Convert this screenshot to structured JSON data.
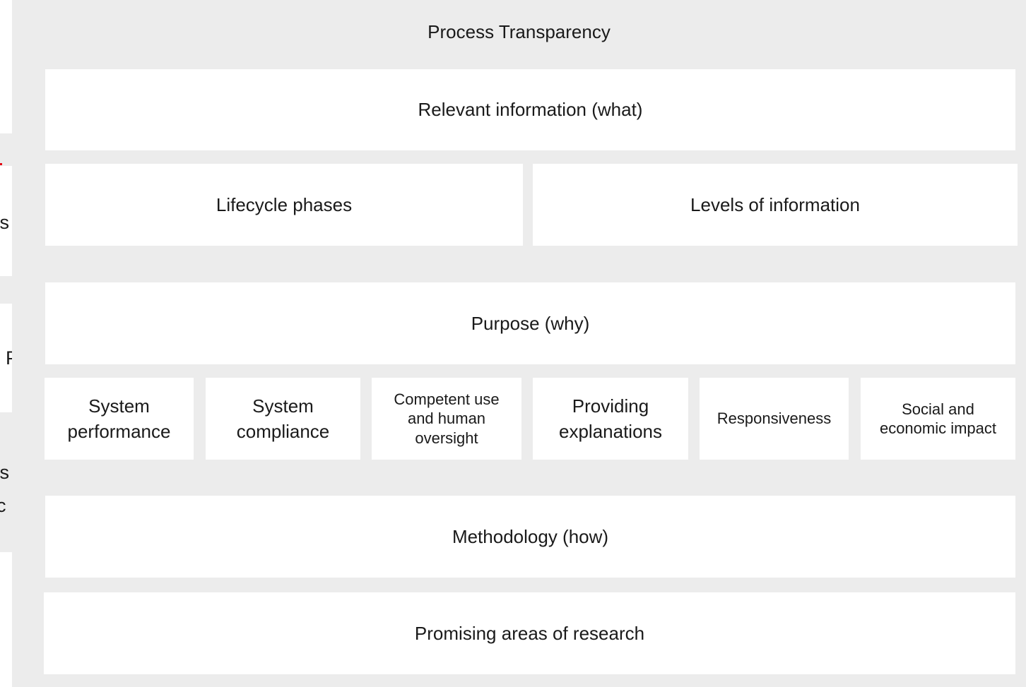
{
  "left_fragments": [
    "ys",
    "P",
    "ys",
    "rc"
  ],
  "title": "Process Transparency",
  "what": "Relevant information (what)",
  "lifecycle": "Lifecycle phases",
  "levels": "Levels of information",
  "why": "Purpose (why)",
  "purposes": [
    "System performance",
    "System compliance",
    "Competent use and human oversight",
    "Providing explanations",
    "Responsiveness",
    "Social and economic impact"
  ],
  "how": "Methodology (how)",
  "research": "Promising areas of research",
  "colors": {
    "panel": "#ececec",
    "box": "#ffffff",
    "accent": "#e30613"
  }
}
